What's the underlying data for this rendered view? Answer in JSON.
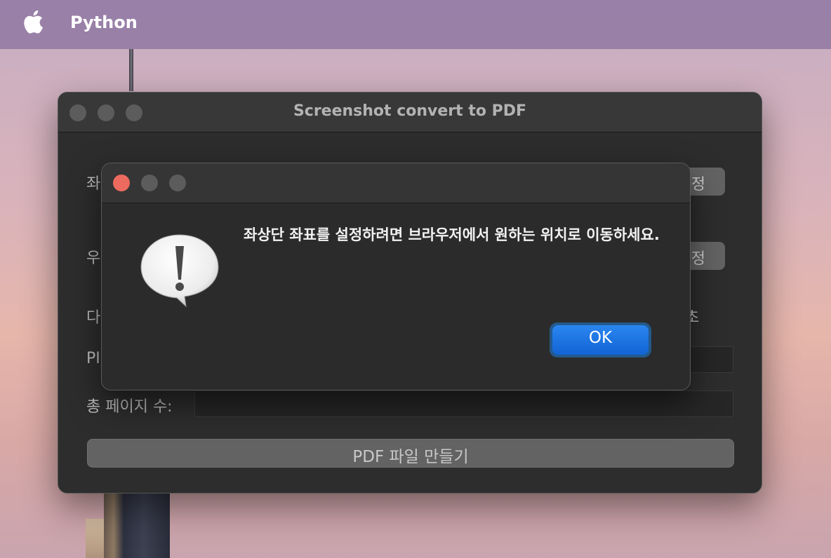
{
  "menubar": {
    "app_name": "Python"
  },
  "main_window": {
    "title": "Screenshot convert to PDF",
    "rows": {
      "top_left_label_partial": "좌",
      "top_left_button_partial": "정",
      "bottom_right_label_partial": "우",
      "bottom_right_button_partial": "정",
      "delay_label_partial": "다",
      "delay_suffix_partial": "초",
      "pdf_label_partial": "PI",
      "total_pages_label": "총 페이지 수:"
    },
    "make_pdf_button": "PDF 파일 만들기"
  },
  "alert": {
    "message": "좌상단 좌표를 설정하려면 브라우저에서 원하는 위치로 이동하세요.",
    "ok_button": "OK",
    "icon": "caution-speech-bubble-icon"
  },
  "colors": {
    "ok_accent": "#1a72e6",
    "close_red": "#ed6a5e"
  }
}
